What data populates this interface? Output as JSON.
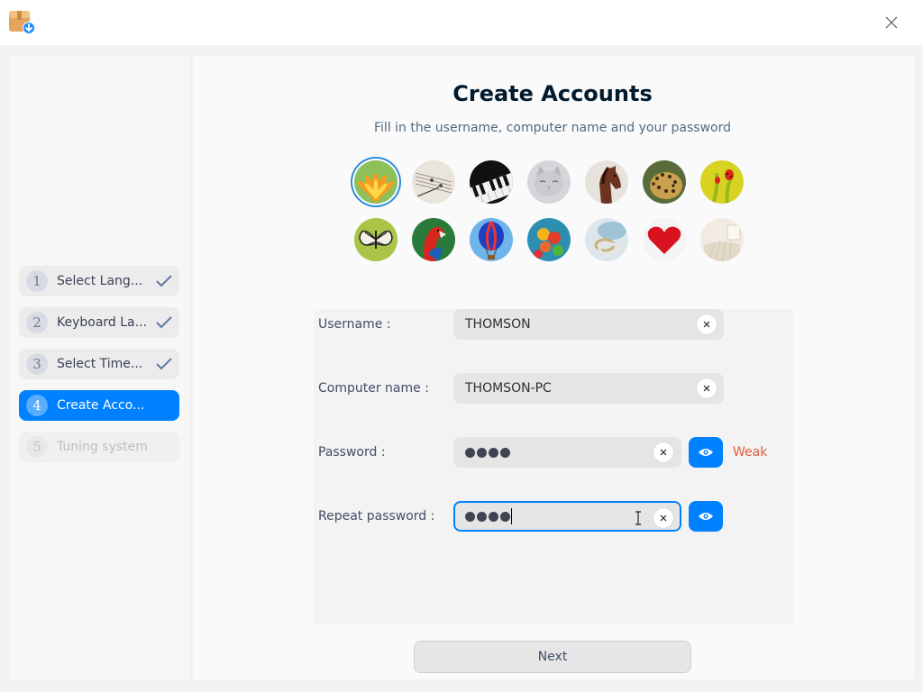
{
  "window": {
    "app_icon": "installer-package-icon",
    "close_icon": "close-icon"
  },
  "steps": [
    {
      "number": "1",
      "label": "Select Lang...",
      "state": "done"
    },
    {
      "number": "2",
      "label": "Keyboard La...",
      "state": "done"
    },
    {
      "number": "3",
      "label": "Select Time...",
      "state": "done"
    },
    {
      "number": "4",
      "label": "Create Acco...",
      "state": "active"
    },
    {
      "number": "5",
      "label": "Tuning system",
      "state": "disabled"
    }
  ],
  "page": {
    "title": "Create Accounts",
    "subtitle": "Fill in the username, computer name and your password"
  },
  "avatars": {
    "selected": "flowers",
    "items": [
      "flowers",
      "sheet-music",
      "piano-keys",
      "kitten",
      "horse",
      "leopard",
      "ladybug",
      "butterfly",
      "parrot",
      "hot-air-balloon",
      "balloons",
      "rings",
      "heart",
      "bedroom"
    ]
  },
  "form": {
    "username": {
      "label": "Username :",
      "value": "THOMSON"
    },
    "computer_name": {
      "label": "Computer name :",
      "value": "THOMSON-PC"
    },
    "password": {
      "label": "Password :",
      "masked_length": 4,
      "strength": "Weak"
    },
    "repeat_password": {
      "label": "Repeat password :",
      "masked_length": 4
    }
  },
  "actions": {
    "next_label": "Next"
  },
  "colors": {
    "accent": "#0081ff",
    "weak": "#e05f3c",
    "selected_ring": "#2e8bd8"
  }
}
